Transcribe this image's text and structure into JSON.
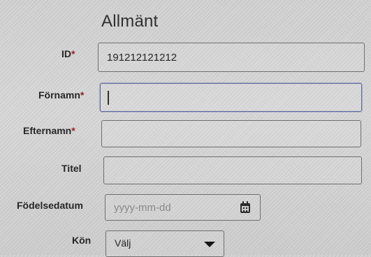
{
  "section": {
    "title": "Allmänt"
  },
  "fields": {
    "id": {
      "label": "ID",
      "required_mark": "*",
      "value": "191212121212"
    },
    "fornamn": {
      "label": "Förnamn",
      "required_mark": "*",
      "value": ""
    },
    "efternamn": {
      "label": "Efternamn",
      "required_mark": "*",
      "value": ""
    },
    "titel": {
      "label": "Titel",
      "value": ""
    },
    "fodelsedatum": {
      "label": "Födelsedatum",
      "placeholder": "yyyy-mm-dd",
      "icon": "calendar-icon"
    },
    "kon": {
      "label": "Kön",
      "selected": "Välj",
      "icon": "chevron-down-icon"
    }
  }
}
